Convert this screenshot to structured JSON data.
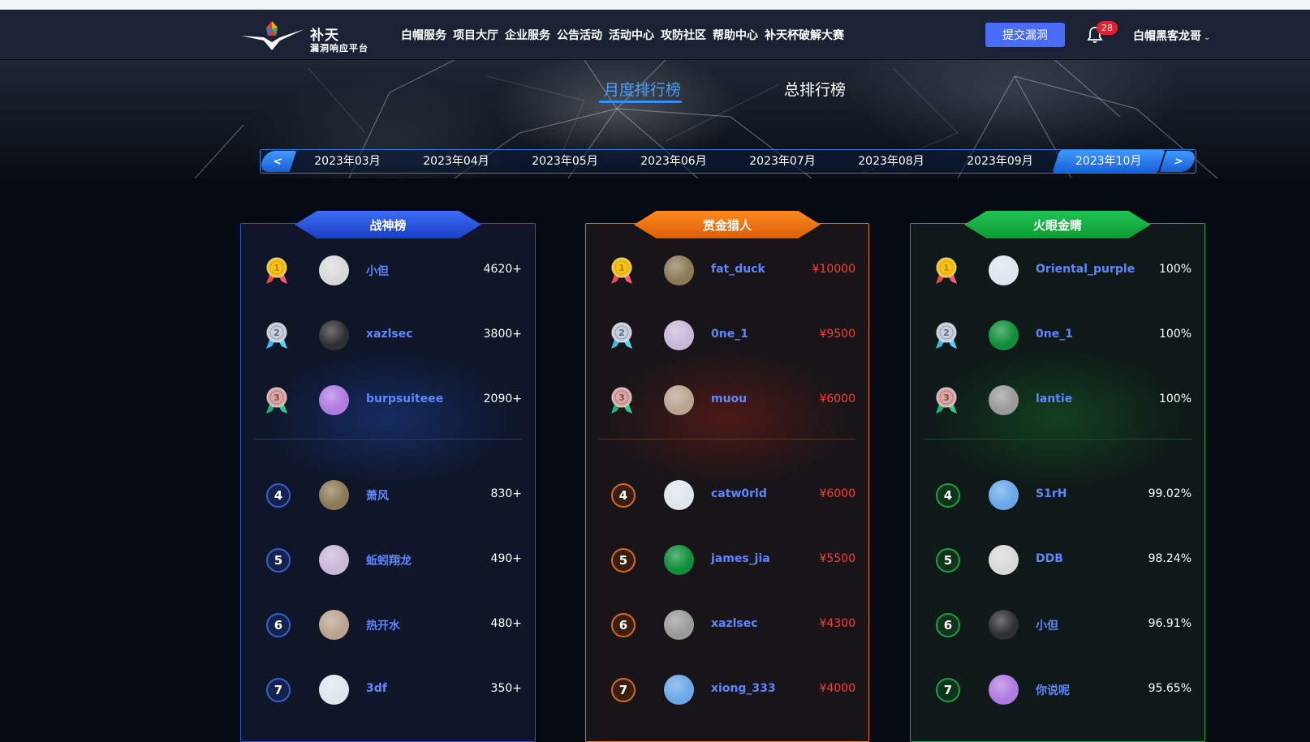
{
  "brand": {
    "title": "补天",
    "subtitle": "漏洞响应平台"
  },
  "nav": {
    "items": [
      "白帽服务",
      "项目大厅",
      "企业服务",
      "公告活动",
      "活动中心",
      "攻防社区",
      "帮助中心",
      "补天杯破解大赛"
    ],
    "submit_label": "提交漏洞",
    "notification_count": "28",
    "user_name": "白帽黑客龙哥"
  },
  "tabs": {
    "monthly": "月度排行榜",
    "total": "总排行榜"
  },
  "months": {
    "prev": "<",
    "next": ">",
    "items": [
      "2023年03月",
      "2023年04月",
      "2023年05月",
      "2023年06月",
      "2023年07月",
      "2023年08月",
      "2023年09月",
      "2023年10月"
    ],
    "selected": "2023年10月"
  },
  "colors": {
    "blue_board": "#2a56d6",
    "orange_board": "#e8751c",
    "green_board": "#17a940",
    "username": "#5d86ff",
    "money": "#ff3b30"
  },
  "boards": [
    {
      "title": "战神榜",
      "rows": [
        {
          "rank": "1",
          "name": "小但",
          "score": "4620+"
        },
        {
          "rank": "2",
          "name": "xazlsec",
          "score": "3800+"
        },
        {
          "rank": "3",
          "name": "burpsuiteee",
          "score": "2090+"
        },
        {
          "rank": "4",
          "name": "萧风",
          "score": "830+"
        },
        {
          "rank": "5",
          "name": "蚯蚓翔龙",
          "score": "490+"
        },
        {
          "rank": "6",
          "name": "热开水",
          "score": "480+"
        },
        {
          "rank": "7",
          "name": "3df",
          "score": "350+"
        }
      ]
    },
    {
      "title": "赏金猎人",
      "rows": [
        {
          "rank": "1",
          "name": "fat_duck",
          "score": "¥10000"
        },
        {
          "rank": "2",
          "name": "0ne_1",
          "score": "¥9500"
        },
        {
          "rank": "3",
          "name": "muou",
          "score": "¥6000"
        },
        {
          "rank": "4",
          "name": "catw0rld",
          "score": "¥6000"
        },
        {
          "rank": "5",
          "name": "james_jia",
          "score": "¥5500"
        },
        {
          "rank": "6",
          "name": "xazlsec",
          "score": "¥4300"
        },
        {
          "rank": "7",
          "name": "xiong_333",
          "score": "¥4000"
        }
      ]
    },
    {
      "title": "火眼金睛",
      "rows": [
        {
          "rank": "1",
          "name": "Oriental_purple",
          "score": "100%"
        },
        {
          "rank": "2",
          "name": "0ne_1",
          "score": "100%"
        },
        {
          "rank": "3",
          "name": "lantie",
          "score": "100%"
        },
        {
          "rank": "4",
          "name": "S1rH",
          "score": "99.02%"
        },
        {
          "rank": "5",
          "name": "DDB",
          "score": "98.24%"
        },
        {
          "rank": "6",
          "name": "小但",
          "score": "96.91%"
        },
        {
          "rank": "7",
          "name": "你说呢",
          "score": "95.65%"
        }
      ]
    }
  ]
}
